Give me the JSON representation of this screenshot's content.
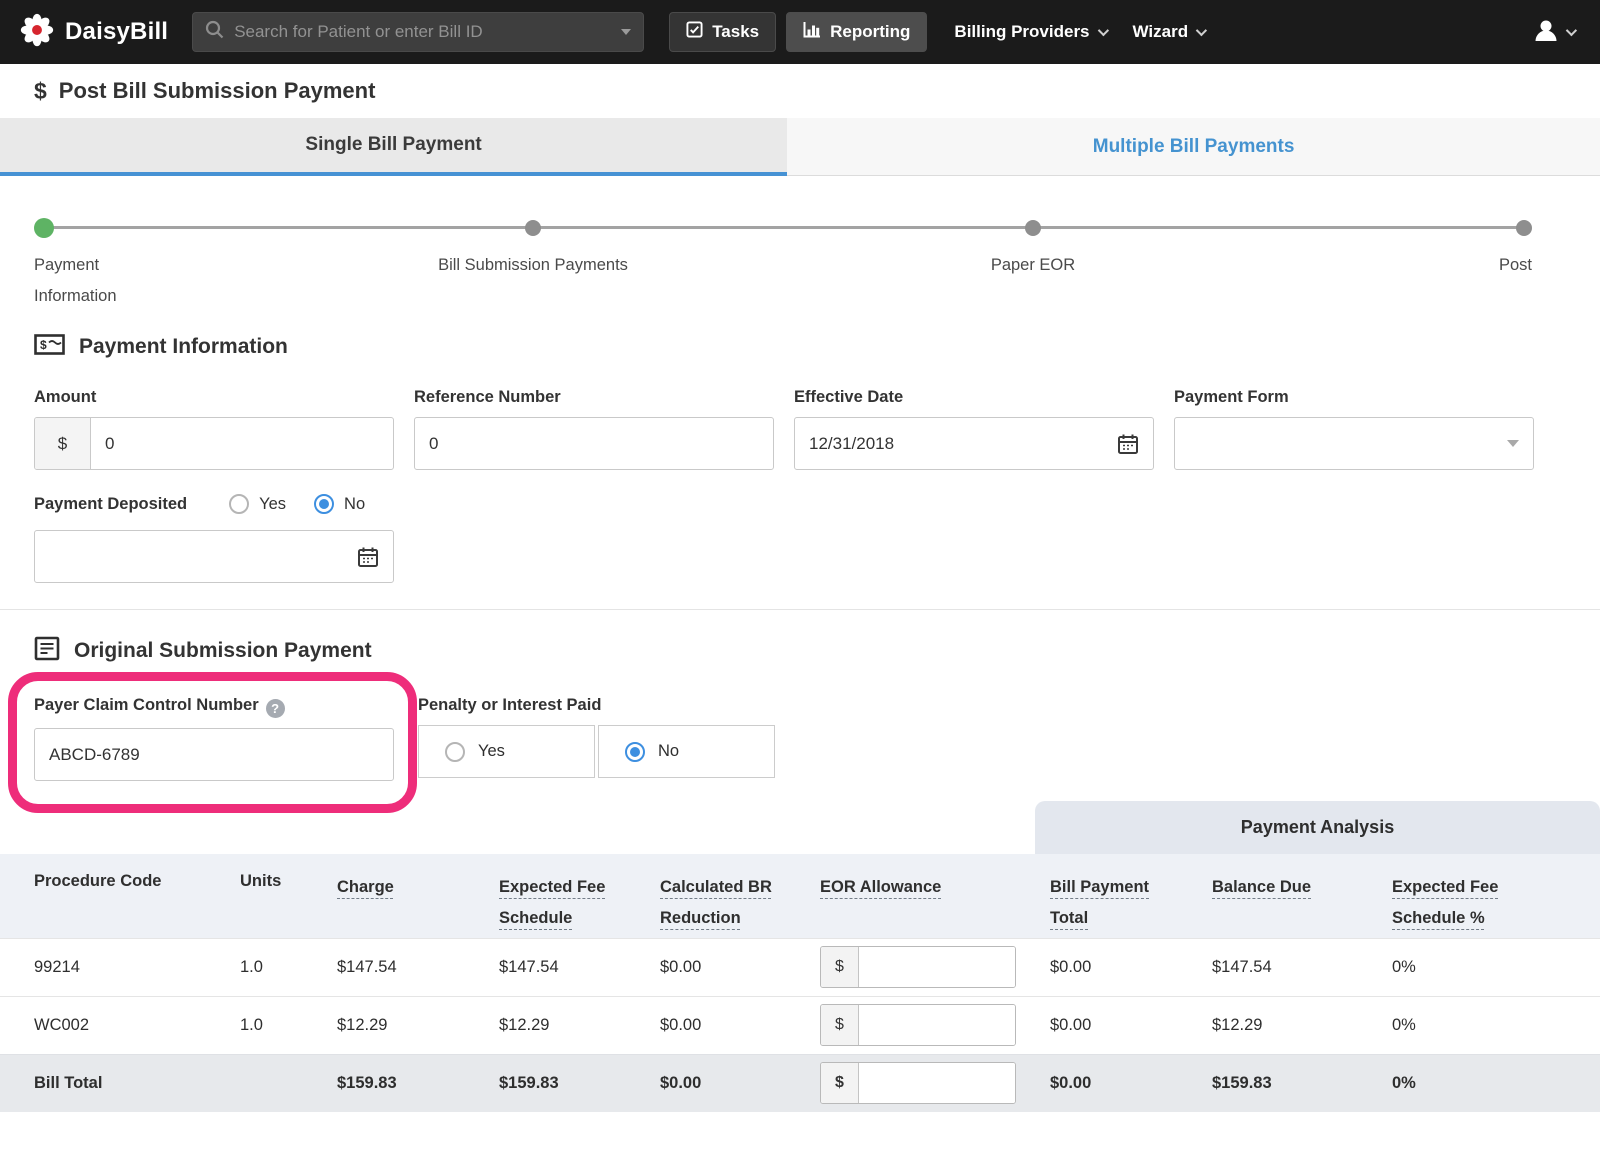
{
  "nav": {
    "brand": "DaisyBill",
    "search": {
      "placeholder": "Search for Patient or enter Bill ID"
    },
    "tasks_label": "Tasks",
    "reporting_label": "Reporting",
    "billing_providers_label": "Billing Providers",
    "wizard_label": "Wizard"
  },
  "page": {
    "title_icon": "$",
    "title": "Post Bill Submission Payment"
  },
  "tabs": {
    "single": "Single Bill Payment",
    "multiple": "Multiple Bill Payments"
  },
  "stepper": {
    "step1": "Payment Information",
    "step2": "Bill Submission Payments",
    "step3": "Paper EOR",
    "step4": "Post"
  },
  "payment_information": {
    "heading": "Payment Information",
    "amount_label": "Amount",
    "amount_prefix": "$",
    "amount_value": "0",
    "reference_label": "Reference Number",
    "reference_value": "0",
    "effective_date_label": "Effective Date",
    "effective_date_value": "12/31/2018",
    "payment_form_label": "Payment Form",
    "payment_form_value": "",
    "deposited_label": "Payment Deposited",
    "deposited_yes": "Yes",
    "deposited_no": "No",
    "deposited_selected": "No",
    "deposit_date_value": ""
  },
  "original_submission": {
    "heading": "Original Submission Payment",
    "pccn_label": "Payer Claim Control Number",
    "pccn_help": "?",
    "pccn_value": "ABCD-6789",
    "penalty_label": "Penalty or Interest Paid",
    "penalty_yes": "Yes",
    "penalty_no": "No",
    "penalty_selected": "No"
  },
  "table": {
    "payment_analysis": "Payment Analysis",
    "columns": [
      "Procedure Code",
      "Units",
      "Charge",
      "Expected Fee Schedule",
      "Calculated BR Reduction",
      "EOR Allowance",
      "Bill Payment Total",
      "Balance Due",
      "Expected Fee Schedule %"
    ],
    "rows": [
      {
        "code": "99214",
        "units": "1.0",
        "charge": "$147.54",
        "expected": "$147.54",
        "calc_br": "$0.00",
        "eor_prefix": "$",
        "eor_value": "",
        "bill_payment": "$0.00",
        "balance": "$147.54",
        "expected_pct": "0%"
      },
      {
        "code": "WC002",
        "units": "1.0",
        "charge": "$12.29",
        "expected": "$12.29",
        "calc_br": "$0.00",
        "eor_prefix": "$",
        "eor_value": "",
        "bill_payment": "$0.00",
        "balance": "$12.29",
        "expected_pct": "0%"
      }
    ],
    "total": {
      "label": "Bill Total",
      "units": "",
      "charge": "$159.83",
      "expected": "$159.83",
      "calc_br": "$0.00",
      "eor_prefix": "$",
      "eor_value": "",
      "bill_payment": "$0.00",
      "balance": "$159.83",
      "expected_pct": "0%"
    }
  },
  "colors": {
    "accent_blue": "#4692d4",
    "step_green": "#5eb364",
    "annotation_pink": "#ee2d7a",
    "nav_bg": "#1b1b1b"
  }
}
